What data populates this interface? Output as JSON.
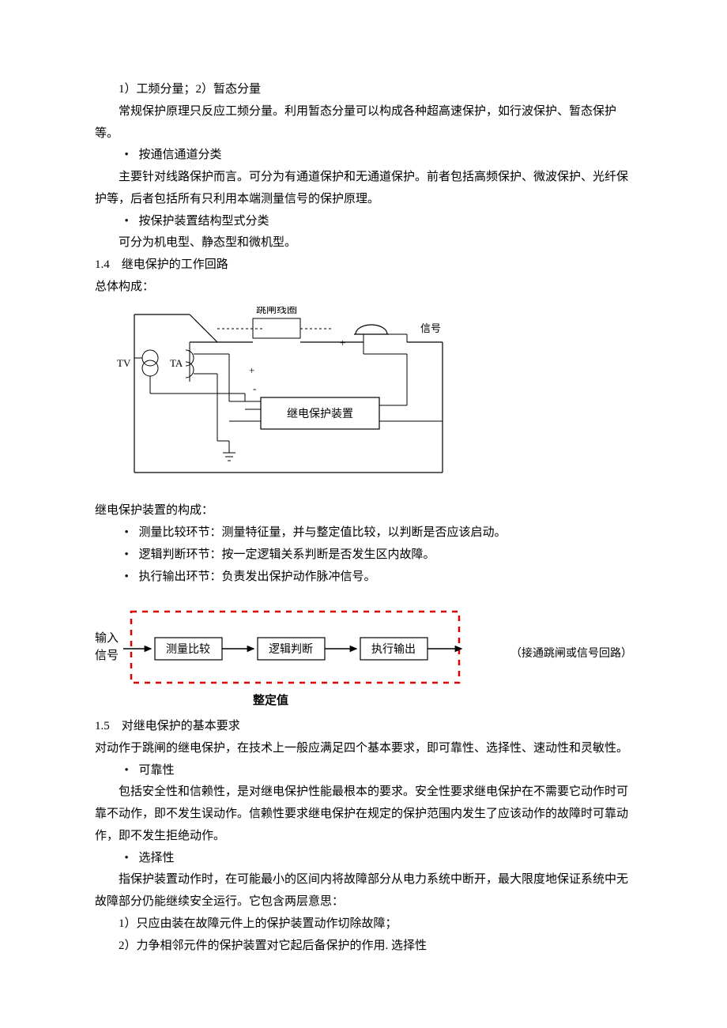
{
  "p1": "1）工频分量；2）暂态分量",
  "p2": "常规保护原理只反应工频分量。利用暂态分量可以构成各种超高速保护，如行波保护、暂态保护等。",
  "b1": "按通信通道分类",
  "p3": "主要针对线路保护而言。可分为有通道保护和无通道保护。前者包括高频保护、微波保护、光纤保护等，后者包括所有只利用本端测量信号的保护原理。",
  "b2": "按保护装置结构型式分类",
  "p4": "可分为机电型、静态型和微机型。",
  "sec14": "1.4　继电保护的工作回路",
  "p5": "总体构成：",
  "diagram1": {
    "tv": "TV",
    "ta": "TA",
    "coil": "跳闸线圈",
    "signal": "信号",
    "device": "继电保护装置"
  },
  "p6": "继电保护装置的构成：",
  "bb1": "测量比较环节：测量特征量，并与整定值比较，以判断是否应该启动。",
  "bb2": "逻辑判断环节：按一定逻辑关系判断是否发生区内故障。",
  "bb3": "执行输出环节：负责发出保护动作脉冲信号。",
  "diagram2": {
    "input1": "输入",
    "input2": "信号",
    "box1": "测量比较",
    "box2": "逻辑判断",
    "box3": "执行输出",
    "note": "（接通跳闸或信号回路）",
    "setting": "整定值"
  },
  "sec15": "1.5　对继电保护的基本要求",
  "p7": "对动作于跳闸的继电保护，在技术上一般应满足四个基本要求，即可靠性、选择性、速动性和灵敏性。",
  "b3": "可靠性",
  "p8": "包括安全性和信赖性，是对继电保护性能最根本的要求。安全性要求继电保护在不需要它动作时可靠不动作，即不发生误动作。信赖性要求继电保护在规定的保护范围内发生了应该动作的故障时可靠动作，即不发生拒绝动作。",
  "b4": "选择性",
  "p9": "指保护装置动作时，在可能最小的区间内将故障部分从电力系统中断开，最大限度地保证系统中无故障部分仍能继续安全运行。它包含两层意思：",
  "p10": "1）只应由装在故障元件上的保护装置动作切除故障；",
  "p11": "2）力争相邻元件的保护装置对它起后备保护的作用. 选择性"
}
